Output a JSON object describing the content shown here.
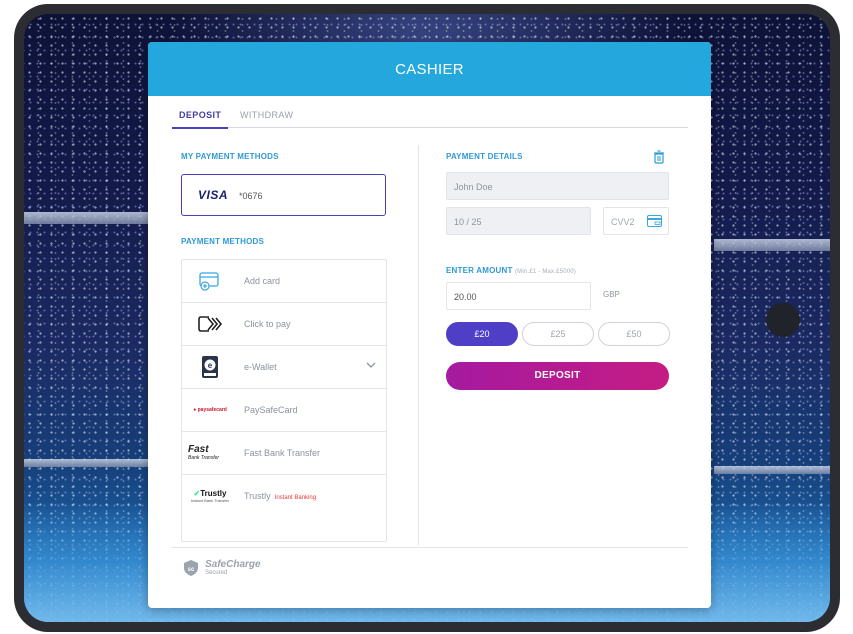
{
  "header": {
    "title": "CASHIER"
  },
  "tabs": [
    {
      "label": "DEPOSIT",
      "active": true
    },
    {
      "label": "WITHDRAW",
      "active": false
    }
  ],
  "my_payment_methods": {
    "title": "MY PAYMENT METHODS",
    "saved_card": {
      "brand": "VISA",
      "digits": "*0676"
    }
  },
  "payment_methods": {
    "title": "PAYMENT METHODS",
    "items": [
      {
        "label": "Add card",
        "icon": "add-card-icon"
      },
      {
        "label": "Click to pay",
        "icon": "click-to-pay-icon"
      },
      {
        "label": "e-Wallet",
        "icon": "e-wallet-icon"
      },
      {
        "label": "PaySafeCard",
        "icon": "paysafecard-logo",
        "logo_text": "paysafecard"
      },
      {
        "label": "Fast Bank Transfer",
        "icon": "fast-bank-transfer-logo",
        "logo_text": "Fast",
        "logo_subtext": "Bank Transfer"
      },
      {
        "label": "Trustly",
        "icon": "trustly-logo",
        "badge": "Instant Banking",
        "logo_text": "Trustly",
        "logo_subtext": "Instant Bank Transfer"
      }
    ]
  },
  "payment_details": {
    "title": "PAYMENT DETAILS",
    "name": "John Doe",
    "expiry": "10 / 25",
    "cvv_placeholder": "CVV2"
  },
  "amount": {
    "title": "ENTER AMOUNT",
    "limits": "(Min.£1 - Max.£5000)",
    "value": "20.00",
    "currency": "GBP",
    "presets": [
      {
        "label": "£20",
        "active": true
      },
      {
        "label": "£25",
        "active": false
      },
      {
        "label": "£50",
        "active": false
      }
    ]
  },
  "deposit_button": "DEPOSIT",
  "footer": {
    "brand": "SafeCharge",
    "sub": "Secured",
    "badge": "sc"
  },
  "colors": {
    "header": "#23a7dc",
    "accent": "#4e3fc6",
    "deposit_button": "#b81b92",
    "section_title": "#2e9ad6"
  }
}
